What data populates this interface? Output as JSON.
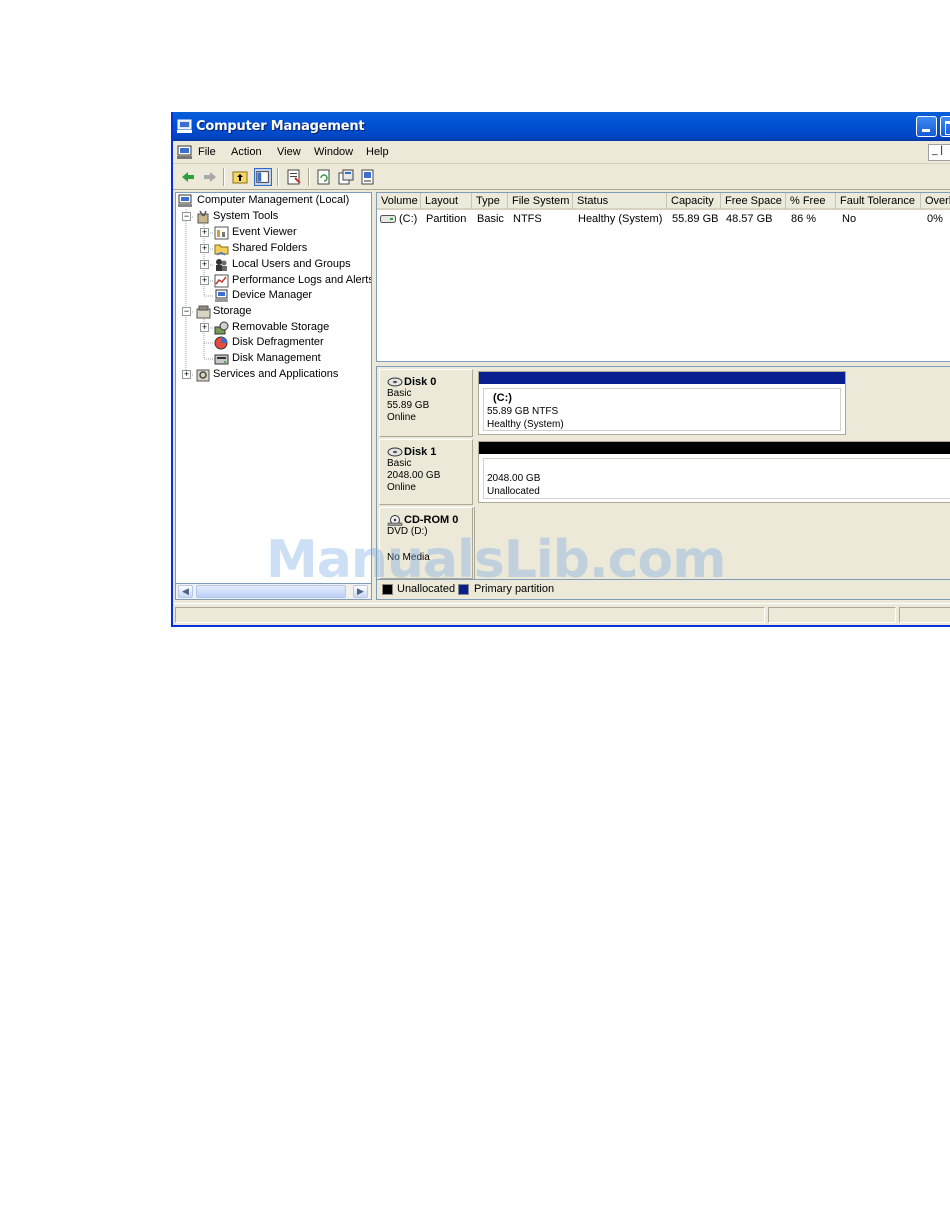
{
  "window": {
    "title": "Computer Management"
  },
  "menubar": {
    "items": [
      "File",
      "Action",
      "View",
      "Window",
      "Help"
    ],
    "mdi_controls": "_ |"
  },
  "tree": {
    "root": "Computer Management (Local)",
    "system_tools": "System Tools",
    "event_viewer": "Event Viewer",
    "shared_folders": "Shared Folders",
    "local_users": "Local Users and Groups",
    "perf_logs": "Performance Logs and Alerts",
    "device_manager": "Device Manager",
    "storage": "Storage",
    "removable_storage": "Removable Storage",
    "disk_defrag": "Disk Defragmenter",
    "disk_management": "Disk Management",
    "services_apps": "Services and Applications"
  },
  "volume_list": {
    "columns": [
      "Volume",
      "Layout",
      "Type",
      "File System",
      "Status",
      "Capacity",
      "Free Space",
      "% Free",
      "Fault Tolerance",
      "Overl"
    ],
    "rows": [
      {
        "volume": "(C:)",
        "layout": "Partition",
        "type": "Basic",
        "file_system": "NTFS",
        "status": "Healthy (System)",
        "capacity": "55.89 GB",
        "free_space": "48.57 GB",
        "pct_free": "86 %",
        "fault_tolerance": "No",
        "overhead": "0%"
      }
    ]
  },
  "disks": {
    "disk0": {
      "name": "Disk 0",
      "type": "Basic",
      "size": "55.89 GB",
      "state": "Online",
      "volume": {
        "title": "(C:)",
        "size": "55.89 GB NTFS",
        "status": "Healthy (System)",
        "bar_color": "#0a1f8f"
      }
    },
    "disk1": {
      "name": "Disk 1",
      "type": "Basic",
      "size": "2048.00 GB",
      "state": "Online",
      "volume": {
        "size": "2048.00 GB",
        "status": "Unallocated",
        "bar_color": "#000000"
      }
    },
    "cdrom0": {
      "name": "CD-ROM 0",
      "type": "DVD (D:)",
      "state": "No Media"
    }
  },
  "legend": {
    "unallocated": "Unallocated",
    "primary": "Primary partition",
    "unallocated_color": "#000000",
    "primary_color": "#0a1f8f"
  },
  "watermark": "ManualsLib.com"
}
